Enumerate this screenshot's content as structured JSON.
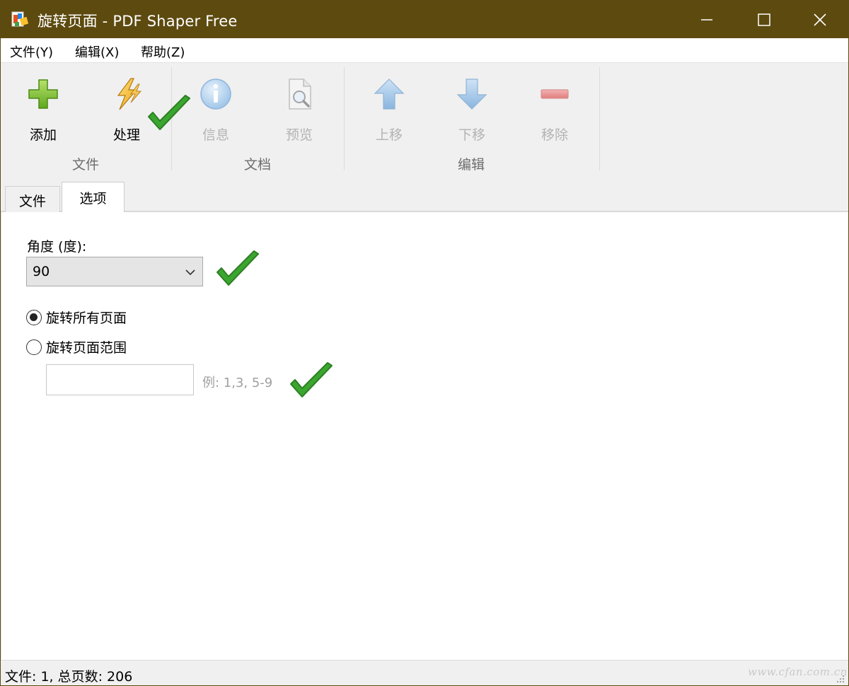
{
  "window": {
    "title": "旋转页面 - PDF Shaper Free"
  },
  "menu": {
    "items": [
      {
        "label": "文件(Y)"
      },
      {
        "label": "编辑(X)"
      },
      {
        "label": "帮助(Z)"
      }
    ]
  },
  "ribbon": {
    "buttons": {
      "add": {
        "label": "添加",
        "icon": "plus-icon",
        "enabled": true
      },
      "process": {
        "label": "处理",
        "icon": "lightning-icon",
        "enabled": true
      },
      "info": {
        "label": "信息",
        "icon": "info-icon",
        "enabled": false
      },
      "preview": {
        "label": "预览",
        "icon": "preview-icon",
        "enabled": false
      },
      "move_up": {
        "label": "上移",
        "icon": "arrow-up-icon",
        "enabled": false
      },
      "move_down": {
        "label": "下移",
        "icon": "arrow-down-icon",
        "enabled": false
      },
      "remove": {
        "label": "移除",
        "icon": "minus-icon",
        "enabled": false
      }
    },
    "groups": {
      "file": "文件",
      "document": "文档",
      "edit": "编辑"
    }
  },
  "tabs": {
    "file": "文件",
    "options": "选项",
    "active": "选项"
  },
  "options": {
    "angle_label": "角度 (度):",
    "angle_value": "90",
    "rotate_all_label": "旋转所有页面",
    "rotate_range_label": "旋转页面范围",
    "rotate_mode": "all",
    "range_value": "",
    "range_hint": "例: 1,3, 5-9"
  },
  "status": {
    "text": "文件: 1, 总页数: 206"
  },
  "watermark": "www.cfan.com.cn",
  "colors": {
    "titlebar": "#5d4a0f",
    "ribbon_bg": "#f0f0f0",
    "check_green": "#3aa62f"
  }
}
